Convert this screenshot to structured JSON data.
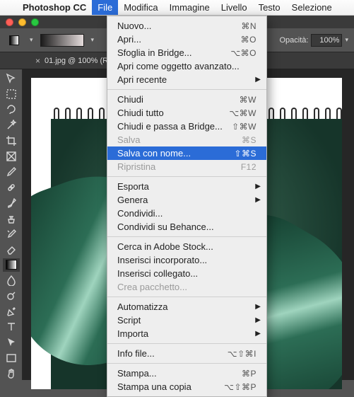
{
  "menubar": {
    "appname": "Photoshop CC",
    "items": [
      "File",
      "Modifica",
      "Immagine",
      "Livello",
      "Testo",
      "Selezione"
    ],
    "active_index": 0
  },
  "traffic": {
    "close": "#ff5f57",
    "min": "#febc2e",
    "max": "#28c840"
  },
  "options": {
    "opacity_label": "Opacità:",
    "opacity_value": "100%"
  },
  "doc": {
    "tab_title": "01.jpg @ 100% (R"
  },
  "menu": {
    "groups": [
      [
        {
          "label": "Nuovo...",
          "shortcut": "⌘N"
        },
        {
          "label": "Apri...",
          "shortcut": "⌘O"
        },
        {
          "label": "Sfoglia in Bridge...",
          "shortcut": "⌥⌘O"
        },
        {
          "label": "Apri come oggetto avanzato..."
        },
        {
          "label": "Apri recente",
          "submenu": true
        }
      ],
      [
        {
          "label": "Chiudi",
          "shortcut": "⌘W"
        },
        {
          "label": "Chiudi tutto",
          "shortcut": "⌥⌘W"
        },
        {
          "label": "Chiudi e passa a Bridge...",
          "shortcut": "⇧⌘W"
        },
        {
          "label": "Salva",
          "shortcut": "⌘S",
          "disabled": true
        },
        {
          "label": "Salva con nome...",
          "shortcut": "⇧⌘S",
          "hover": true
        },
        {
          "label": "Ripristina",
          "shortcut": "F12",
          "disabled": true
        }
      ],
      [
        {
          "label": "Esporta",
          "submenu": true
        },
        {
          "label": "Genera",
          "submenu": true
        },
        {
          "label": "Condividi..."
        },
        {
          "label": "Condividi su Behance..."
        }
      ],
      [
        {
          "label": "Cerca in Adobe Stock..."
        },
        {
          "label": "Inserisci incorporato..."
        },
        {
          "label": "Inserisci collegato..."
        },
        {
          "label": "Crea pacchetto...",
          "disabled": true
        }
      ],
      [
        {
          "label": "Automatizza",
          "submenu": true
        },
        {
          "label": "Script",
          "submenu": true
        },
        {
          "label": "Importa",
          "submenu": true
        }
      ],
      [
        {
          "label": "Info file...",
          "shortcut": "⌥⇧⌘I"
        }
      ],
      [
        {
          "label": "Stampa...",
          "shortcut": "⌘P"
        },
        {
          "label": "Stampa una copia",
          "shortcut": "⌥⇧⌘P"
        }
      ]
    ]
  },
  "tools": [
    "move",
    "marquee",
    "lasso",
    "magic-wand",
    "crop",
    "frame",
    "eyedropper",
    "healing",
    "brush",
    "clone",
    "history-brush",
    "eraser",
    "gradient",
    "blur",
    "dodge",
    "pen",
    "type",
    "path-select",
    "rectangle",
    "hand"
  ],
  "tool_selected_index": 12
}
